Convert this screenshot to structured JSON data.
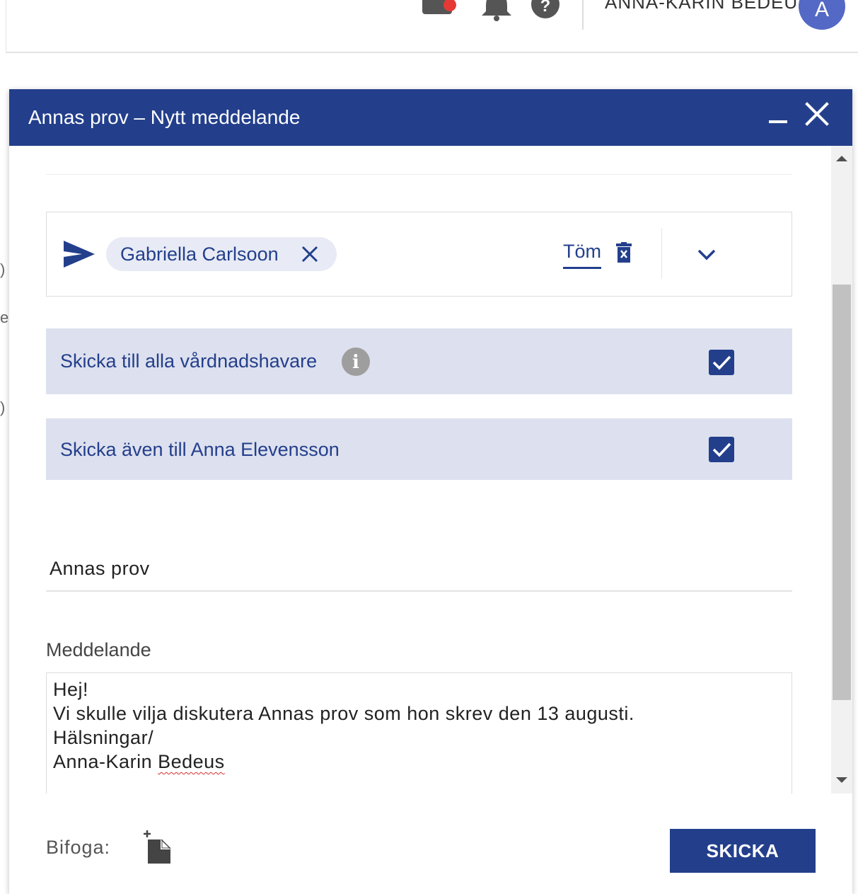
{
  "topbar": {
    "user_name": "ANNA-KARIN BEDEUS",
    "avatar_initial": "A",
    "help_symbol": "?"
  },
  "dialog": {
    "title": "Annas prov – Nytt meddelande",
    "recipients": {
      "chips": [
        {
          "label": "Gabriella Carlsoon"
        }
      ],
      "clear_label": "Töm"
    },
    "options": [
      {
        "label": "Skicka till alla vårdnadshavare",
        "checked": true,
        "has_info": true
      },
      {
        "label": "Skicka även till Anna Elevensson",
        "checked": true,
        "has_info": false
      }
    ],
    "info_symbol": "i",
    "subject": "Annas prov",
    "message_label": "Meddelande",
    "message_lines": [
      "Hej!",
      "Vi skulle vilja diskutera Annas prov som hon skrev den 13 augusti.",
      "Hälsningar/"
    ],
    "signature_first": "Anna-Karin",
    "signature_last": "Bedeus",
    "attach_label": "Bifoga:",
    "send_label": "SKICKA"
  },
  "colors": {
    "brand": "#233f8c",
    "option_bg": "#dde0ee",
    "chip_bg": "#e8ebf5",
    "notification": "#e53935",
    "avatar": "#5469c6"
  },
  "icons": [
    "mail-icon",
    "bell-icon",
    "help-icon",
    "send-icon",
    "close-icon",
    "trash-icon",
    "chevron-down-icon",
    "info-icon",
    "check-icon",
    "attach-file-icon",
    "minimize-icon"
  ]
}
